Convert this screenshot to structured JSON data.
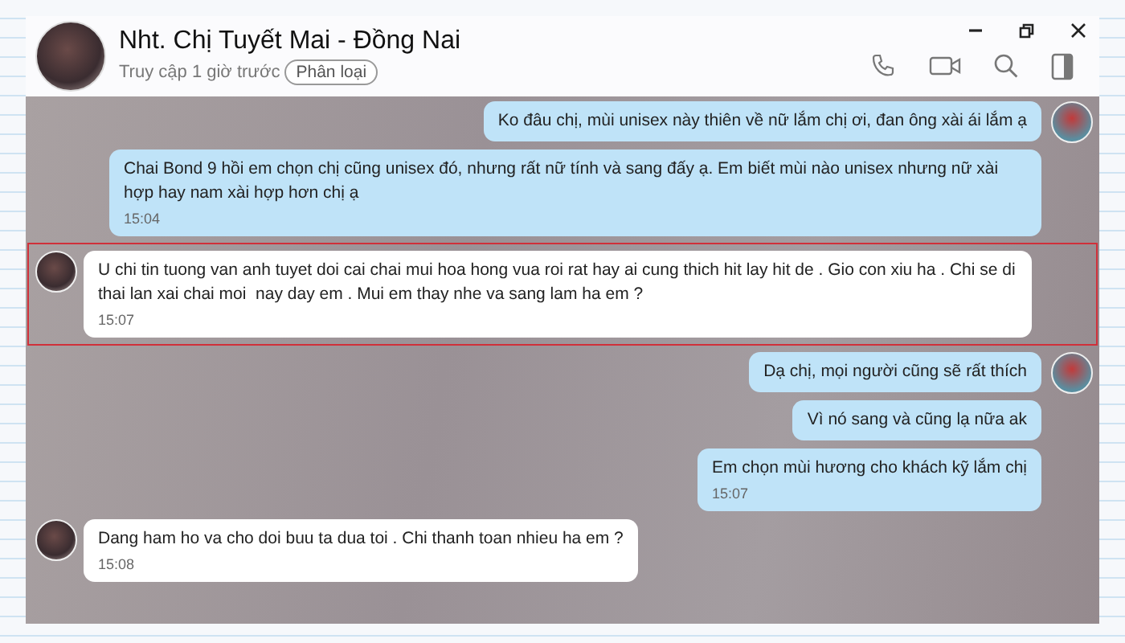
{
  "header": {
    "title": "Nht. Chị Tuyết Mai - Đồng Nai",
    "status": "Truy cập 1 giờ trước",
    "tag": "Phân loại"
  },
  "messages": [
    {
      "kind": "me",
      "avatar": true,
      "highlighted": false,
      "text": "Ko đâu chị, mùi unisex này thiên về nữ lắm chị ơi, đan ông xài ái lắm ạ"
    },
    {
      "kind": "me",
      "avatar": false,
      "highlighted": false,
      "text": "Chai Bond 9 hồi em chọn chị cũng unisex đó, nhưng rất nữ tính và sang đấy ạ. Em biết mùi nào unisex nhưng nữ xài hợp hay nam xài hợp hơn chị ạ",
      "time": "15:04"
    },
    {
      "kind": "them",
      "avatar": true,
      "highlighted": true,
      "text": "U chi tin tuong van anh tuyet doi cai chai mui hoa hong vua roi rat hay ai cung thich hit lay hit de . Gio con xiu ha . Chi se di thai lan xai chai moi  nay day em . Mui em thay nhe va sang lam ha em ?",
      "time": "15:07"
    },
    {
      "kind": "me",
      "avatar": true,
      "highlighted": false,
      "text": "Dạ chị, mọi người cũng sẽ rất thích"
    },
    {
      "kind": "me",
      "avatar": false,
      "highlighted": false,
      "text": "Vì nó sang và cũng lạ nữa ak"
    },
    {
      "kind": "me",
      "avatar": false,
      "highlighted": false,
      "text": "Em chọn mùi hương cho khách kỹ lắm chị",
      "time": "15:07"
    },
    {
      "kind": "them",
      "avatar": true,
      "highlighted": false,
      "text": "Dang ham ho va cho doi buu ta dua toi . Chi thanh toan nhieu ha em ?",
      "time": "15:08"
    }
  ]
}
